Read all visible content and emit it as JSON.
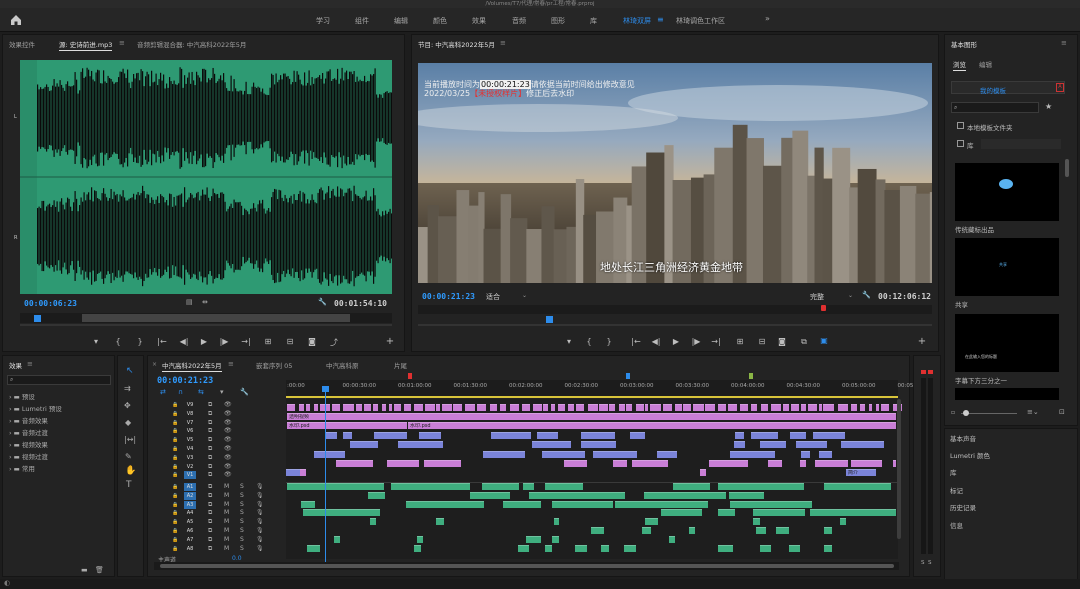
{
  "window": {
    "title": "/Volumes/T7/代理/常春/pr工程/常春.prproj"
  },
  "workspaces": [
    {
      "label": "学习",
      "active": false
    },
    {
      "label": "组件",
      "active": false
    },
    {
      "label": "编辑",
      "active": false
    },
    {
      "label": "颜色",
      "active": false
    },
    {
      "label": "效果",
      "active": false
    },
    {
      "label": "音频",
      "active": false
    },
    {
      "label": "图形",
      "active": false
    },
    {
      "label": "库",
      "active": false
    },
    {
      "label": "林琦双屏",
      "active": true
    },
    {
      "label": "林琦调色工作区",
      "active": false
    }
  ],
  "source_panel": {
    "tabs": [
      "效果控件",
      "源: 史诗前进.mp3",
      "音频剪辑混合器: 中汽高科2022年5月"
    ],
    "timecode_in": "00:00:06:23",
    "timecode_dur": "00:01:54:10",
    "channel_labels": [
      "L",
      "R"
    ]
  },
  "program_panel": {
    "tab": "节目: 中汽高科2022年5月",
    "overlay_line1_a": "当前播放时间为",
    "overlay_line1_tc": "00:00:21:23",
    "overlay_line1_b": "请依据当前时间给出修改意见",
    "overlay_line2_a": "2022/03/25",
    "overlay_line2_red": "【未授权样片】",
    "overlay_line2_b": "修正后去水印",
    "subtitle": "地处长江三角洲经济黄金地带",
    "timecode": "00:00:21:23",
    "fit": "适合",
    "quality": "完整",
    "duration": "00:12:06:12"
  },
  "effects_panel": {
    "title": "效果",
    "items": [
      "预设",
      "Lumetri 预设",
      "音频效果",
      "音频过渡",
      "视频效果",
      "视频过渡",
      "常用"
    ]
  },
  "timeline": {
    "tabs": [
      "中汽高科2022年5月",
      "嵌套序列 05",
      "中汽高科原",
      "片尾"
    ],
    "timecode": "00:00:21:23",
    "ruler": [
      ":00:00",
      "00:00:30:00",
      "00:01:00:00",
      "00:01:30:00",
      "00:02:00:00",
      "00:02:30:00",
      "00:03:00:00",
      "00:03:30:00",
      "00:04:00:00",
      "00:04:30:00",
      "00:05:00:00",
      "00:05:"
    ],
    "video_tracks": [
      "V9",
      "V8",
      "V7",
      "V6",
      "V5",
      "V4",
      "V3",
      "V2",
      "V1"
    ],
    "audio_tracks": [
      "A1",
      "A2",
      "A3",
      "A4",
      "A5",
      "A6",
      "A7",
      "A8"
    ],
    "master": "主声道",
    "master_val": "0.0",
    "clip_labels": {
      "transparent": "透明视频",
      "watermark1": "水印.psd",
      "watermark2": "水印.psd",
      "v1_clip": "简介"
    }
  },
  "essential_graphics": {
    "title": "基本图形",
    "tabs": [
      "浏览",
      "编辑"
    ],
    "dropdown": "我的模板",
    "check1": "本地模板文件夹",
    "check2": "库",
    "templates": [
      "传统藏标出品",
      "共享",
      "字幕下方三分之一"
    ],
    "template_mid_text": "共享",
    "template_low_text": "在此输入您的标题"
  },
  "side_sections": [
    "基本声音",
    "Lumetri 颜色",
    "库",
    "标记",
    "历史记录",
    "信息"
  ],
  "meter_labels": [
    "S",
    "S"
  ],
  "colors": {
    "accent": "#2d8ceb",
    "waveform_bg": "#2e9a73",
    "video_clip": "#c97ed6",
    "video_clip2": "#7b84d9",
    "audio_clip": "#3fae7f",
    "yellow": "#d8c43a"
  }
}
